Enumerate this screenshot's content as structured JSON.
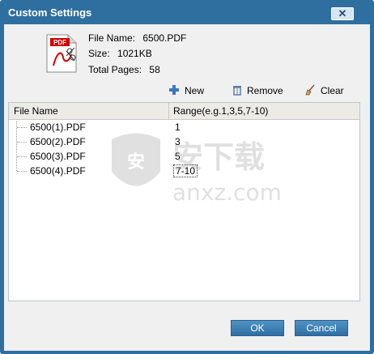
{
  "window": {
    "title": "Custom Settings",
    "close_glyph": "✕"
  },
  "file_info": {
    "name_label": "File Name:",
    "name_value": "6500.PDF",
    "size_label": "Size:",
    "size_value": "1021KB",
    "pages_label": "Total Pages:",
    "pages_value": "58",
    "icon": "pdf-file-icon",
    "icon_badge": "PDF"
  },
  "toolbar": {
    "new_label": "New",
    "remove_label": "Remove",
    "clear_label": "Clear"
  },
  "list": {
    "col_name": "File Name",
    "col_range": "Range(e.g.1,3,5,7-10)",
    "rows": [
      {
        "name": "6500(1).PDF",
        "range": "1"
      },
      {
        "name": "6500(2).PDF",
        "range": "3"
      },
      {
        "name": "6500(3).PDF",
        "range": "5"
      },
      {
        "name": "6500(4).PDF",
        "range": "7-10"
      }
    ]
  },
  "buttons": {
    "ok": "OK",
    "cancel": "Cancel"
  },
  "watermark": {
    "cn": "安下载",
    "domain": "anxz.com"
  },
  "colors": {
    "titlebar": "#2f6f9f",
    "button": "#3a7fb3",
    "accent_icon": "#3a78c2"
  }
}
